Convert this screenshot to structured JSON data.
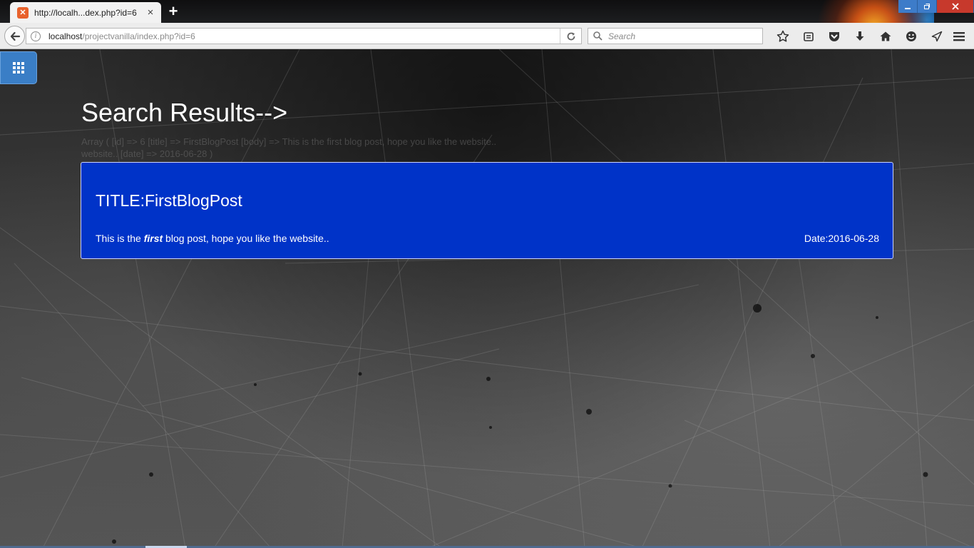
{
  "browser": {
    "tab_title": "http://localh...dex.php?id=6",
    "tab_favicon": "xampp-favicon",
    "url_host": "localhost",
    "url_path": "/projectvanilla/index.php?id=6",
    "search_placeholder": "Search",
    "toolbar_icons": [
      "bookmark-star-icon",
      "reading-list-icon",
      "pocket-icon",
      "download-icon",
      "home-icon",
      "smiley-icon",
      "send-icon"
    ],
    "window_controls": [
      "minimize",
      "restore",
      "close"
    ]
  },
  "page": {
    "apps_button_icon": "grid-icon",
    "heading": "Search Results-->",
    "faint_lines": [
      "Array ( [id] => 6 [title] => FirstBlogPost [body] => This is the first blog post, hope you like the website..",
      "website.. [date] => 2016-06-28 )"
    ],
    "post": {
      "title": "TITLE:FirstBlogPost",
      "body_before": "This is the ",
      "body_emphasis": "first",
      "body_after": " blog post, hope you like the website..",
      "date": "Date:2016-06-28"
    }
  },
  "colors": {
    "post_card_bg": "#0033c8",
    "apps_button_bg": "#3a7ec6",
    "close_button_bg": "#c7392c",
    "window_button_bg": "#3d7cc9"
  }
}
